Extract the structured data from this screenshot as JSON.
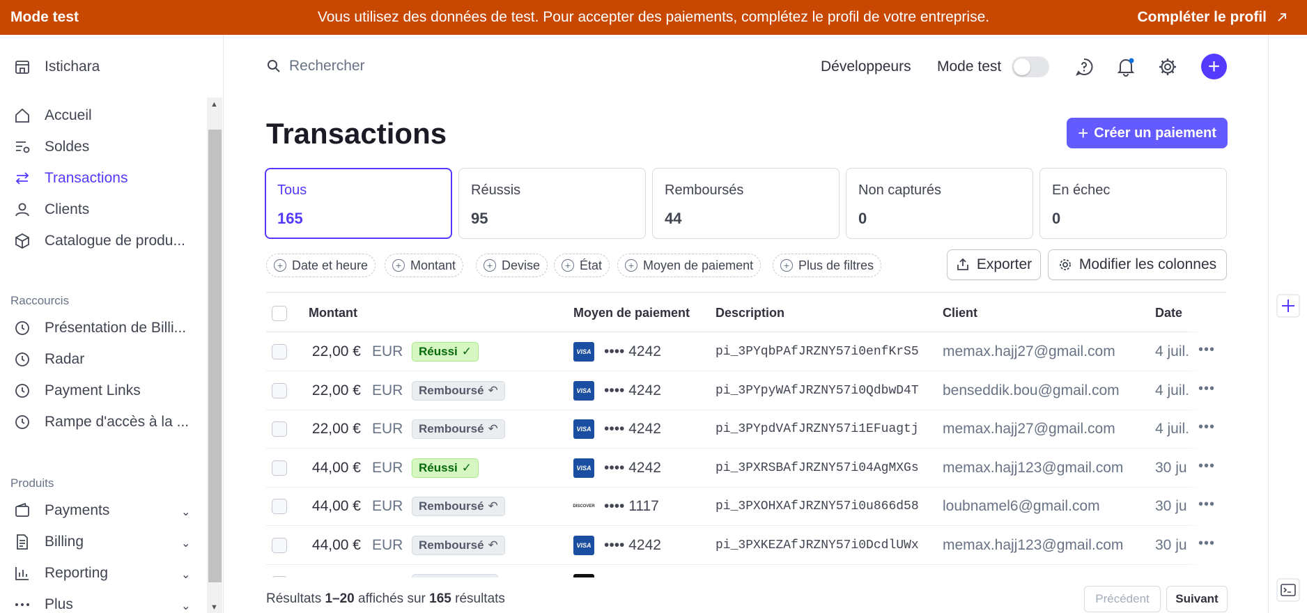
{
  "banner": {
    "mode": "Mode test",
    "message": "Vous utilisez des données de test. Pour accepter des paiements, complétez le profil de votre entreprise.",
    "cta": "Compléter le profil"
  },
  "sidebar": {
    "account": "Istichara",
    "nav": [
      "Accueil",
      "Soldes",
      "Transactions",
      "Clients",
      "Catalogue de produ..."
    ],
    "shortcuts_title": "Raccourcis",
    "shortcuts": [
      "Présentation de Billi...",
      "Radar",
      "Payment Links",
      "Rampe d'accès à la ..."
    ],
    "products_title": "Produits",
    "products": [
      "Payments",
      "Billing",
      "Reporting",
      "Plus"
    ]
  },
  "topbar": {
    "search_placeholder": "Rechercher",
    "developers": "Développeurs",
    "test_mode": "Mode test"
  },
  "page": {
    "title": "Transactions",
    "create_button": "Créer un paiement"
  },
  "tiles": [
    {
      "label": "Tous",
      "count": "165"
    },
    {
      "label": "Réussis",
      "count": "95"
    },
    {
      "label": "Remboursés",
      "count": "44"
    },
    {
      "label": "Non capturés",
      "count": "0"
    },
    {
      "label": "En échec",
      "count": "0"
    }
  ],
  "filters": [
    "Date et heure",
    "Montant",
    "Devise",
    "État",
    "Moyen de paiement",
    "Plus de filtres"
  ],
  "actions": {
    "export": "Exporter",
    "columns": "Modifier les colonnes"
  },
  "table": {
    "headers": {
      "amount": "Montant",
      "method": "Moyen de paiement",
      "description": "Description",
      "client": "Client",
      "date": "Date"
    },
    "rows": [
      {
        "amount": "22,00 €",
        "currency": "EUR",
        "status": "Réussi",
        "card": "VISA",
        "last4": "•••• 4242",
        "description": "pi_3PYqbPAfJRZNY57i0enfKrS5",
        "client": "memax.hajj27@gmail.com",
        "date": "4 juil."
      },
      {
        "amount": "22,00 €",
        "currency": "EUR",
        "status": "Remboursé",
        "card": "VISA",
        "last4": "•••• 4242",
        "description": "pi_3PYpyWAfJRZNY57i0QdbwD4T",
        "client": "benseddik.bou@gmail.com",
        "date": "4 juil."
      },
      {
        "amount": "22,00 €",
        "currency": "EUR",
        "status": "Remboursé",
        "card": "VISA",
        "last4": "•••• 4242",
        "description": "pi_3PYpdVAfJRZNY57i1EFuagtj",
        "client": "memax.hajj27@gmail.com",
        "date": "4 juil."
      },
      {
        "amount": "44,00 €",
        "currency": "EUR",
        "status": "Réussi",
        "card": "VISA",
        "last4": "•••• 4242",
        "description": "pi_3PXRSBAfJRZNY57i04AgMXGs",
        "client": "memax.hajj123@gmail.com",
        "date": "30 ju"
      },
      {
        "amount": "44,00 €",
        "currency": "EUR",
        "status": "Remboursé",
        "card": "DISCOVER",
        "last4": "•••• 1117",
        "description": "pi_3PXOHXAfJRZNY57i0u866d58",
        "client": "loubnamel6@gmail.com",
        "date": "30 ju"
      },
      {
        "amount": "44,00 €",
        "currency": "EUR",
        "status": "Remboursé",
        "card": "VISA",
        "last4": "•••• 4242",
        "description": "pi_3PXKEZAfJRZNY57i0DcdlUWx",
        "client": "memax.hajj123@gmail.com",
        "date": "30 ju"
      }
    ]
  },
  "footer": {
    "prefix": "Résultats",
    "range": "1–20",
    "middle": "affichés sur",
    "total": "165",
    "suffix": "résultats",
    "prev": "Précédent",
    "next": "Suivant"
  }
}
